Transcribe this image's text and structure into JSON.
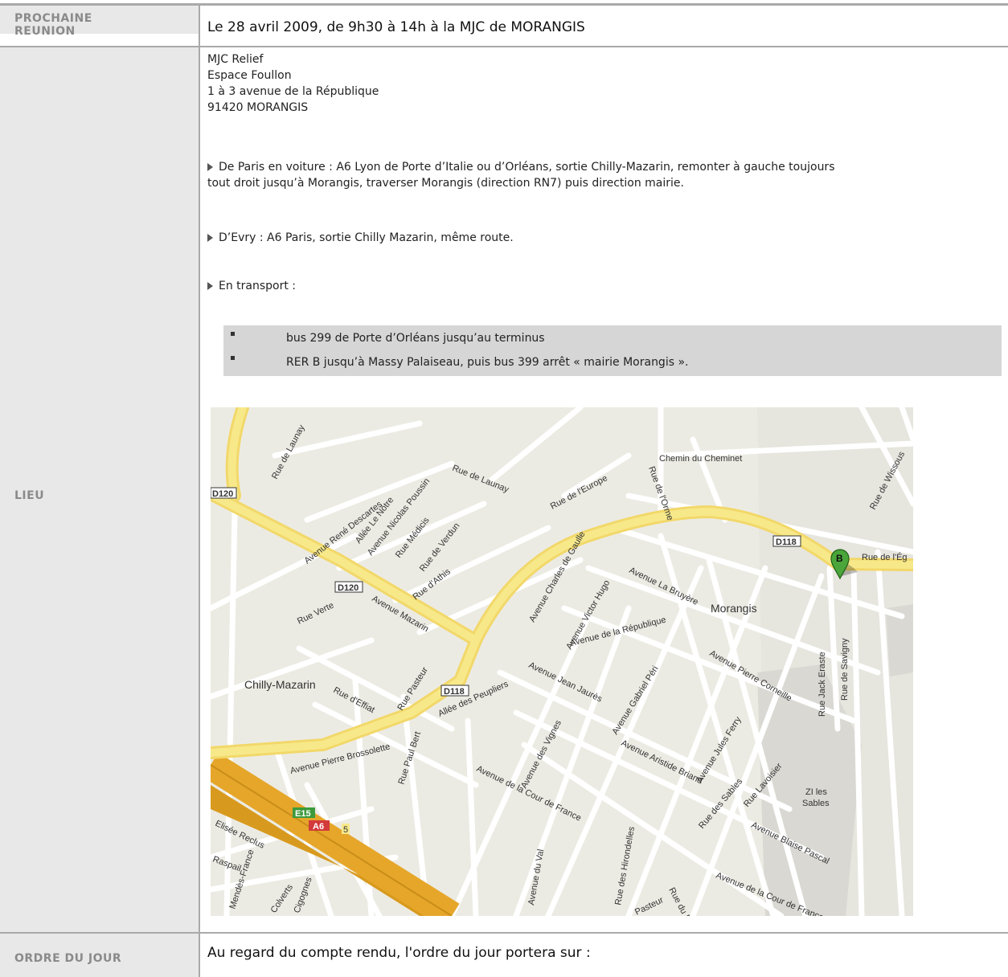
{
  "prochaine": {
    "label_line1": "PROCHAINE",
    "label_line2": "REUNION",
    "text": "Le 28 avril 2009, de 9h30 à 14h à la MJC de MORANGIS"
  },
  "lieu": {
    "label": "LIEU",
    "address": [
      "MJC Relief",
      "Espace Foullon",
      "1 à 3 avenue de la République",
      "91420 MORANGIS"
    ],
    "route1_line1": "De Paris en voiture : A6 Lyon de Porte d’Italie ou d’Orléans, sortie Chilly-Mazarin, remonter à gauche toujours",
    "route1_line2": "tout droit jusqu’à Morangis, traverser Morangis (direction RN7) puis direction mairie.",
    "route2": "D’Evry : A6 Paris, sortie Chilly Mazarin, même route.",
    "route3": "En transport :",
    "bullets": [
      "bus 299 de Porte d’Orléans jusqu’au terminus",
      "RER B jusqu’à Massy Palaiseau, puis bus 399 arrêt « mairie Morangis »."
    ]
  },
  "map": {
    "marker_letter": "B",
    "town_labels": [
      "Morangis",
      "Chilly-Mazarin",
      "ZI les Sables"
    ],
    "road_shields": [
      "D120",
      "D120",
      "D118",
      "D118",
      "E15",
      "A6",
      "5"
    ],
    "street_labels": [
      "Rue de Launay",
      "Avenue René Descartes",
      "Allée Le Nôtre",
      "Avenue Nicolas Poussin",
      "Rue Médicis",
      "Rue de Verdun",
      "Rue d'Athis",
      "Rue de Launay",
      "Rue de l'Europe",
      "Chemin du Cheminet",
      "Rue de l'Orme",
      "Avenue Charles de Gaulle",
      "Avenue Mazarin",
      "Rue Verte",
      "Avenue Victor Hugo",
      "Avenue La Bruyère",
      "Avenue de la République",
      "Avenue Pierre Corneille",
      "Avenue Jean Jaurès",
      "Avenue Gabriel Péri",
      "Rue Pasteur",
      "Allée des Peupliers",
      "Rue d'Effiat",
      "Avenue Pierre Brossolette",
      "Rue Paul Bert",
      "Avenue des Vignes",
      "Avenue de la Cour de France",
      "Avenue Aristide Briand",
      "Avenue Jules Ferry",
      "Rue des Sables",
      "Rue Lavoisier",
      "Avenue Blaise Pascal",
      "Rue de l'Ég",
      "Rue Jack Eraste",
      "Rue de Savigny",
      "Rue de Wissous",
      "Avenue du Val",
      "Rue des Hirondelles",
      "Elisée Reclus",
      "Raspail",
      "Mendès-France",
      "Colverts",
      "Cigognes",
      "Pasteur",
      "Rue du Bel"
    ]
  },
  "ordre": {
    "label": "ORDRE DU JOUR",
    "text": "Au regard du compte rendu, l'ordre du jour portera sur :"
  }
}
